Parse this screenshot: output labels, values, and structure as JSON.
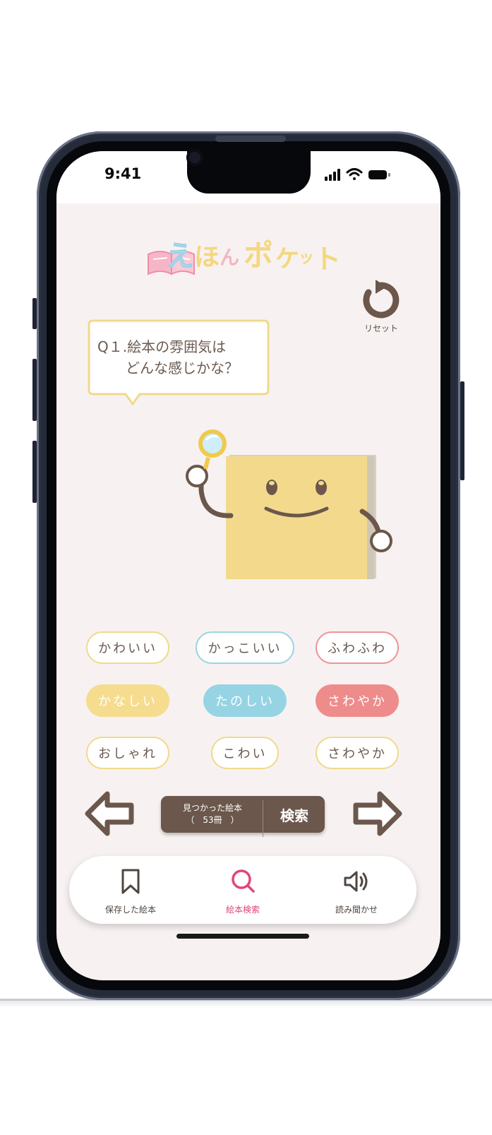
{
  "status": {
    "time": "9:41"
  },
  "app": {
    "logo_text": "えほんポケット"
  },
  "reset": {
    "label": "リセット"
  },
  "question": {
    "text": "Q１.絵本の雰囲気は\n　　どんな感じかな？"
  },
  "choices": [
    {
      "label": "かわいい",
      "style": "outline-yellow"
    },
    {
      "label": "かっこいい",
      "style": "outline-blue"
    },
    {
      "label": "ふわふわ",
      "style": "outline-red"
    },
    {
      "label": "かなしい",
      "style": "filled-yellow"
    },
    {
      "label": "たのしい",
      "style": "filled-blue"
    },
    {
      "label": "さわやか",
      "style": "filled-red"
    },
    {
      "label": "おしゃれ",
      "style": "outline-yellow"
    },
    {
      "label": "こわい",
      "style": "outline-yellow"
    },
    {
      "label": "さわやか",
      "style": "outline-yellow"
    }
  ],
  "nav": {
    "prev_icon": "arrow-left-icon",
    "next_icon": "arrow-right-icon"
  },
  "search": {
    "found_label": "見つかった絵本",
    "found_count": "（　53冊　）",
    "button_label": "検索"
  },
  "tabs": [
    {
      "label": "保存した絵本",
      "icon": "bookmark-icon",
      "active": false
    },
    {
      "label": "絵本検索",
      "icon": "search-icon",
      "active": true
    },
    {
      "label": "読み聞かせ",
      "icon": "speaker-icon",
      "active": false
    }
  ],
  "colors": {
    "brown": "#6b574b",
    "screen_bg": "#f7f2f1",
    "accent_pink": "#e2457a",
    "chip_yellow": "#f1d98c",
    "chip_blue": "#9dd4e2",
    "chip_red": "#ee9596",
    "book_yellow": "#f3d98c"
  }
}
